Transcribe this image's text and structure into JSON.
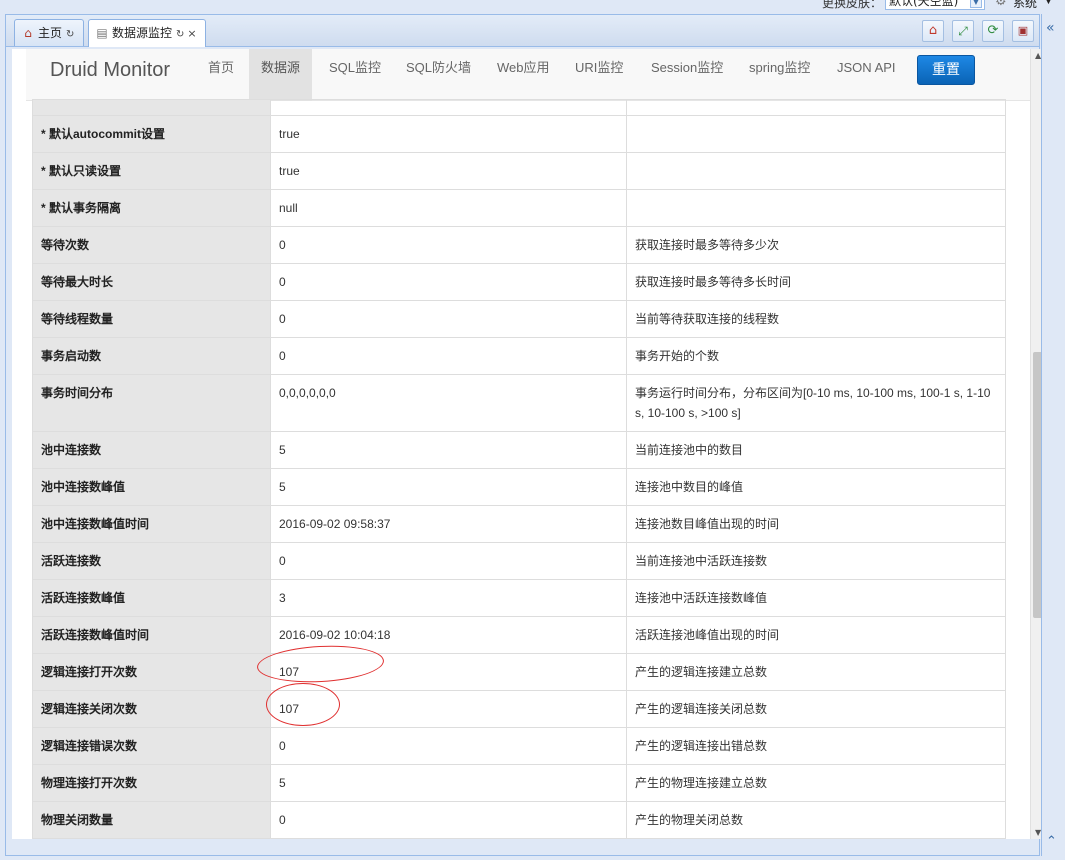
{
  "system": {
    "skin_label": "更换皮肤：",
    "skin_value": "默认(天空蓝)",
    "system_label": "系统"
  },
  "tabs": [
    {
      "label": "主页",
      "icon": "home-icon"
    },
    {
      "label": "数据源监控",
      "icon": "database-icon"
    }
  ],
  "nav": {
    "brand": "Druid Monitor",
    "items": [
      "首页",
      "数据源",
      "SQL监控",
      "SQL防火墙",
      "Web应用",
      "URI监控",
      "Session监控",
      "spring监控",
      "JSON API"
    ],
    "active": "数据源",
    "reset_label": "重置"
  },
  "rows": [
    {
      "key": "* 默认autocommit设置",
      "value": "true",
      "desc": ""
    },
    {
      "key": "* 默认只读设置",
      "value": "true",
      "desc": ""
    },
    {
      "key": "* 默认事务隔离",
      "value": "null",
      "desc": ""
    },
    {
      "key": "等待次数",
      "value": "0",
      "desc": "获取连接时最多等待多少次"
    },
    {
      "key": "等待最大时长",
      "value": "0",
      "desc": "获取连接时最多等待多长时间"
    },
    {
      "key": "等待线程数量",
      "value": "0",
      "desc": "当前等待获取连接的线程数"
    },
    {
      "key": "事务启动数",
      "value": "0",
      "desc": "事务开始的个数"
    },
    {
      "key": "事务时间分布",
      "value": "0,0,0,0,0,0",
      "desc": "事务运行时间分布，分布区间为[0-10 ms, 10-100 ms, 100-1 s, 1-10 s, 10-100 s, >100 s]"
    },
    {
      "key": "池中连接数",
      "value": "5",
      "desc": "当前连接池中的数目"
    },
    {
      "key": "池中连接数峰值",
      "value": "5",
      "desc": "连接池中数目的峰值"
    },
    {
      "key": "池中连接数峰值时间",
      "value": "2016-09-02 09:58:37",
      "desc": "连接池数目峰值出现的时间"
    },
    {
      "key": "活跃连接数",
      "value": "0",
      "desc": "当前连接池中活跃连接数"
    },
    {
      "key": "活跃连接数峰值",
      "value": "3",
      "desc": "连接池中活跃连接数峰值"
    },
    {
      "key": "活跃连接数峰值时间",
      "value": "2016-09-02 10:04:18",
      "desc": "活跃连接池峰值出现的时间"
    },
    {
      "key": "逻辑连接打开次数",
      "value": "107",
      "desc": "产生的逻辑连接建立总数"
    },
    {
      "key": "逻辑连接关闭次数",
      "value": "107",
      "desc": "产生的逻辑连接关闭总数"
    },
    {
      "key": "逻辑连接错误次数",
      "value": "0",
      "desc": "产生的逻辑连接出错总数"
    },
    {
      "key": "物理连接打开次数",
      "value": "5",
      "desc": "产生的物理连接建立总数"
    },
    {
      "key": "物理关闭数量",
      "value": "0",
      "desc": "产生的物理关闭总数"
    }
  ],
  "colors": {
    "accent": "#0a63b5",
    "annotation": "#e03030",
    "key_cell_bg": "#e6e6e6"
  }
}
